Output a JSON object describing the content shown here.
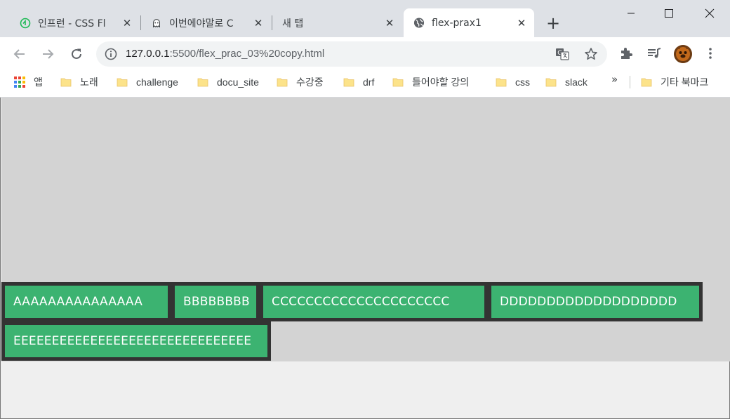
{
  "tabs": [
    {
      "title": "인프런 - CSS Fl",
      "icon": "inflearn-icon",
      "active": false
    },
    {
      "title": "이번에야말로 C",
      "icon": "ghost-icon",
      "active": false
    },
    {
      "title": "새 탭",
      "icon": "",
      "active": false
    },
    {
      "title": "flex-prax1",
      "icon": "globe-icon",
      "active": true
    }
  ],
  "window": {
    "new_tab": "+"
  },
  "address": {
    "host": "127.0.0.1",
    "path": ":5500/flex_prac_03%20copy.html"
  },
  "bookmarks": {
    "apps_label": "앱",
    "items": [
      "노래",
      "challenge",
      "docu_site",
      "수강중",
      "drf",
      "들어야할 강의",
      "css",
      "slack"
    ],
    "overflow": "»",
    "other": "기타 북마크"
  },
  "flex_items": [
    "AAAAAAAAAAAAAAA",
    "BBBBBBBB",
    "CCCCCCCCCCCCCCCCCCCCC",
    "DDDDDDDDDDDDDDDDDDD",
    "EEEEEEEEEEEEEEEEEEEEEEEEEEEEEEE"
  ],
  "colors": {
    "item_bg": "#3cb371",
    "item_border": "#333333",
    "container_bg": "#d3d3d3"
  }
}
